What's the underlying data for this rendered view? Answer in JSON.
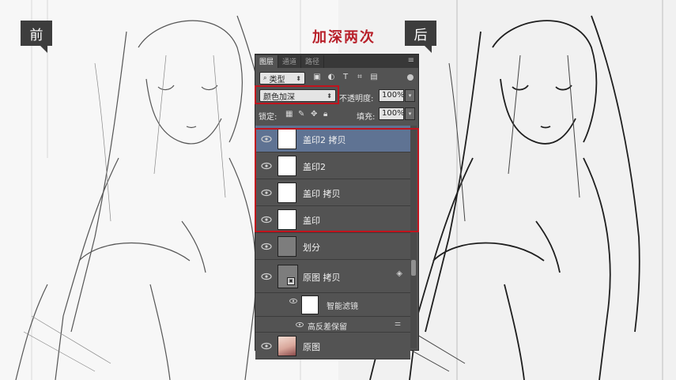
{
  "labels": {
    "before": "前",
    "after": "后",
    "headline": "加深两次"
  },
  "panel": {
    "tabs": [
      "图层",
      "通道",
      "路径"
    ],
    "menu_icon": "≡",
    "filter": {
      "value": "类型",
      "icon": "search-icon"
    },
    "blend_mode": "颜色加深",
    "opacity_label": "不透明度:",
    "opacity_value": "100%",
    "lock_label": "锁定:",
    "fill_label": "填充:",
    "fill_value": "100%",
    "layers": [
      {
        "name": "盖印2 拷贝",
        "selected": true
      },
      {
        "name": "盖印2"
      },
      {
        "name": "盖印 拷贝"
      },
      {
        "name": "盖印"
      },
      {
        "name": "划分"
      },
      {
        "name": "原图 拷贝"
      },
      {
        "name": "智能滤镜"
      },
      {
        "name": "高反差保留"
      },
      {
        "name": "原图"
      }
    ]
  },
  "colors": {
    "highlight": "#c0131d",
    "panel_bg": "#535353",
    "selected_layer": "#5f7393",
    "headline": "#b8202a"
  }
}
